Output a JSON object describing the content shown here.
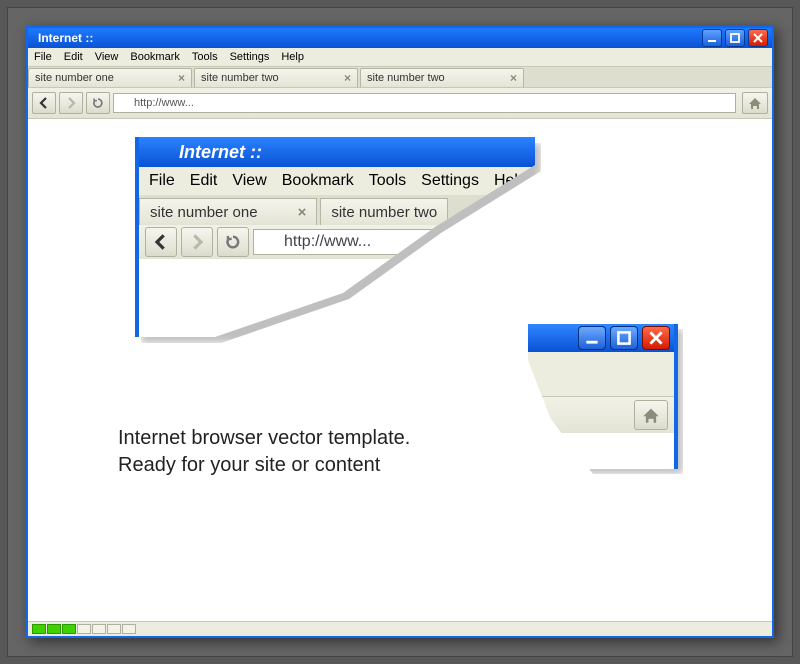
{
  "window": {
    "title": "Internet ::",
    "menu": [
      "File",
      "Edit",
      "View",
      "Bookmark",
      "Tools",
      "Settings",
      "Help"
    ],
    "tabs": [
      {
        "label": "site number one"
      },
      {
        "label": "site number two"
      },
      {
        "label": "site number two"
      }
    ],
    "address": "http://www...",
    "status_segments": [
      "on",
      "on",
      "on",
      "off",
      "off",
      "off",
      "off"
    ]
  },
  "zoom1": {
    "title": "Internet ::",
    "menu": [
      "File",
      "Edit",
      "View",
      "Bookmark",
      "Tools",
      "Settings",
      "Help"
    ],
    "tab1": "site number one",
    "tab2": "site number two",
    "address": "http://www..."
  },
  "body_text": {
    "line1": "Internet browser vector template.",
    "line2": "Ready for your site or content"
  }
}
